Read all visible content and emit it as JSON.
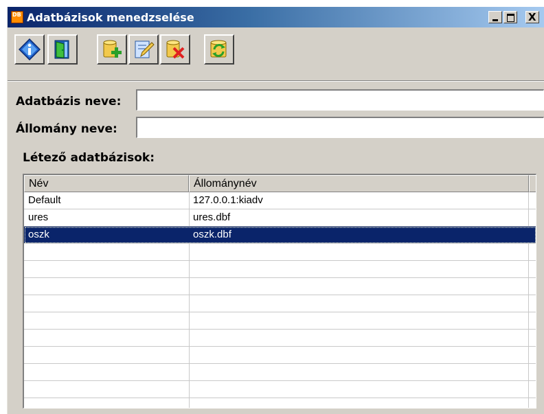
{
  "window": {
    "title": "Adatbázisok menedzselése",
    "controls": {
      "minimize": "_",
      "maximize": "□",
      "close": "X"
    }
  },
  "toolbar": {
    "buttons": [
      {
        "name": "info",
        "icon": "info-icon"
      },
      {
        "name": "exit",
        "icon": "exit-door-icon"
      },
      {
        "name": "add",
        "icon": "database-add-icon"
      },
      {
        "name": "edit",
        "icon": "edit-document-icon"
      },
      {
        "name": "delete",
        "icon": "database-delete-icon"
      },
      {
        "name": "refresh",
        "icon": "database-refresh-icon"
      }
    ]
  },
  "form": {
    "db_name_label": "Adatbázis neve:",
    "db_name_value": "",
    "file_name_label": "Állomány neve:",
    "file_name_value": ""
  },
  "existing_label": "Létező adatbázisok:",
  "list": {
    "columns": [
      "Név",
      "Állománynév"
    ],
    "rows": [
      {
        "name": "Default",
        "file": "127.0.0.1:kiadv"
      },
      {
        "name": "ures",
        "file": "ures.dbf"
      },
      {
        "name": "oszk",
        "file": "oszk.dbf",
        "selected": true
      }
    ],
    "empty_rows": 10
  },
  "colors": {
    "title_start": "#0a246a",
    "title_end": "#a6caf0",
    "face": "#d4d0c8",
    "selection": "#0a246a"
  }
}
